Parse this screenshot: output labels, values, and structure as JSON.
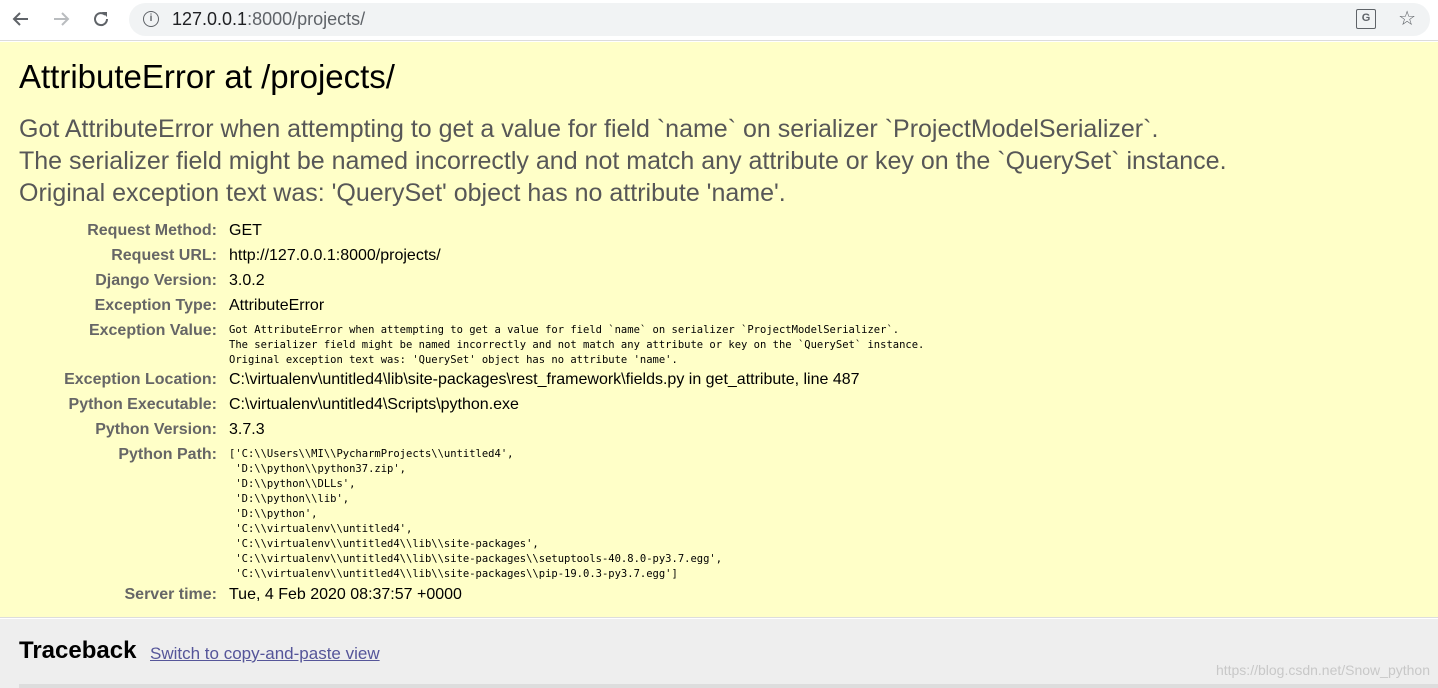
{
  "browser": {
    "url_host": "127.0.0.1",
    "url_rest": ":8000/projects/"
  },
  "error": {
    "title": "AttributeError at /projects/",
    "message_lines": [
      "Got AttributeError when attempting to get a value for field `name` on serializer `ProjectModelSerializer`.",
      "The serializer field might be named incorrectly and not match any attribute or key on the `QuerySet` instance.",
      "Original exception text was: 'QuerySet' object has no attribute 'name'."
    ]
  },
  "meta": {
    "request_method": {
      "label": "Request Method:",
      "value": "GET"
    },
    "request_url": {
      "label": "Request URL:",
      "value": "http://127.0.0.1:8000/projects/"
    },
    "django_version": {
      "label": "Django Version:",
      "value": "3.0.2"
    },
    "exception_type": {
      "label": "Exception Type:",
      "value": "AttributeError"
    },
    "exception_value": {
      "label": "Exception Value:",
      "value": "Got AttributeError when attempting to get a value for field `name` on serializer `ProjectModelSerializer`.\nThe serializer field might be named incorrectly and not match any attribute or key on the `QuerySet` instance.\nOriginal exception text was: 'QuerySet' object has no attribute 'name'."
    },
    "exception_location": {
      "label": "Exception Location:",
      "value": "C:\\virtualenv\\untitled4\\lib\\site-packages\\rest_framework\\fields.py in get_attribute, line 487"
    },
    "python_executable": {
      "label": "Python Executable:",
      "value": "C:\\virtualenv\\untitled4\\Scripts\\python.exe"
    },
    "python_version": {
      "label": "Python Version:",
      "value": "3.7.3"
    },
    "python_path": {
      "label": "Python Path:",
      "value": "['C:\\\\Users\\\\MI\\\\PycharmProjects\\\\untitled4',\n 'D:\\\\python\\\\python37.zip',\n 'D:\\\\python\\\\DLLs',\n 'D:\\\\python\\\\lib',\n 'D:\\\\python',\n 'C:\\\\virtualenv\\\\untitled4',\n 'C:\\\\virtualenv\\\\untitled4\\\\lib\\\\site-packages',\n 'C:\\\\virtualenv\\\\untitled4\\\\lib\\\\site-packages\\\\setuptools-40.8.0-py3.7.egg',\n 'C:\\\\virtualenv\\\\untitled4\\\\lib\\\\site-packages\\\\pip-19.0.3-py3.7.egg']"
    },
    "server_time": {
      "label": "Server time:",
      "value": "Tue, 4 Feb 2020 08:37:57 +0000"
    }
  },
  "traceback": {
    "heading": "Traceback",
    "switch_link": "Switch to copy-and-paste view"
  },
  "watermark": "https://blog.csdn.net/Snow_python",
  "icons": {
    "back": "arrow-left-icon",
    "forward": "arrow-right-icon",
    "reload": "reload-icon",
    "info": "info-icon",
    "translate": "translate-icon",
    "bookmark": "star-icon"
  },
  "colors": {
    "summary_bg": "#ffffc8",
    "traceback_bg": "#eeeeee",
    "label_gray": "#666666",
    "link": "#555599"
  }
}
